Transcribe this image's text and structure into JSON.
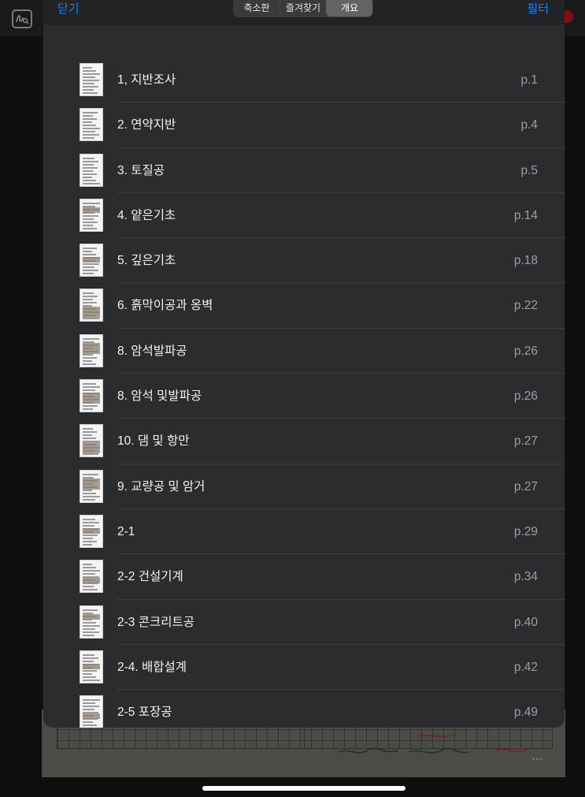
{
  "sheet": {
    "close_label": "닫기",
    "filter_label": "필터",
    "segments": [
      "축소판",
      "즐겨찾기",
      "개요"
    ],
    "active_segment": "개요"
  },
  "outline": [
    {
      "title": "1, 지반조사",
      "page": "p.1"
    },
    {
      "title": "2. 연약지반",
      "page": "p.4"
    },
    {
      "title": "3. 토질공",
      "page": "p.5"
    },
    {
      "title": "4. 얕은기초",
      "page": "p.14"
    },
    {
      "title": "5. 깊은기초",
      "page": "p.18"
    },
    {
      "title": "6. 흙막이공과 옹벽",
      "page": "p.22"
    },
    {
      "title": " 8. 암석발파공",
      "page": "p.26"
    },
    {
      "title": "8. 암석 및발파공",
      "page": "p.26"
    },
    {
      "title": "10. 댐 및 항만",
      "page": "p.27"
    },
    {
      "title": "9. 교량공 및 암거",
      "page": "p.27"
    },
    {
      "title": "2-1",
      "page": "p.29"
    },
    {
      "title": "2-2 건설기계",
      "page": "p.34"
    },
    {
      "title": "2-3 콘크리트공",
      "page": "p.40"
    },
    {
      "title": "2-4. 배합설계",
      "page": "p.42"
    },
    {
      "title": "2-5 포장공",
      "page": "p.49"
    }
  ],
  "colors": {
    "accent": "#0a84ff",
    "sheet_bg": "#2c2c2e",
    "text_primary": "#f2f2f2",
    "text_secondary": "#9d9da2"
  }
}
